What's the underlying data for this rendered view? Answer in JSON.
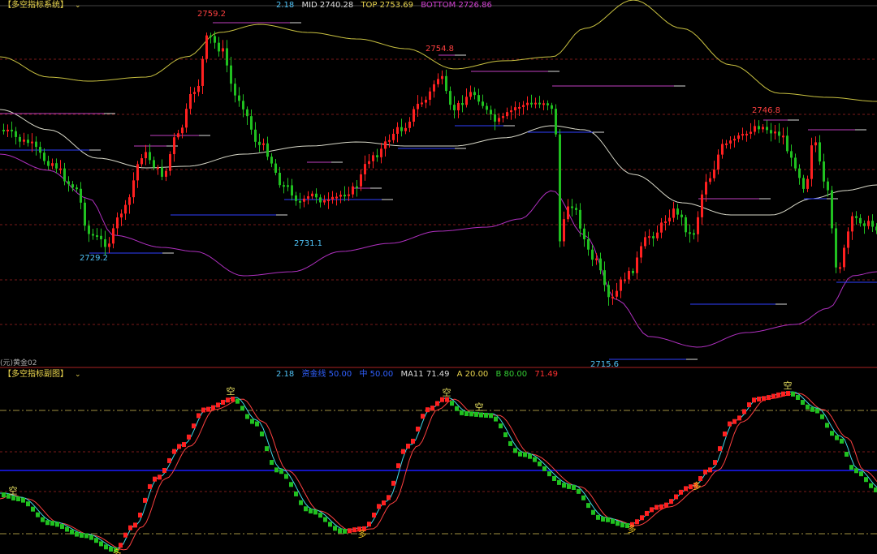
{
  "main_panel": {
    "title": "【多空指标系统】",
    "readouts": [
      {
        "text": "2.18",
        "color": "#4fc3f7"
      },
      {
        "text": "MID 2740.28",
        "color": "#dddddd"
      },
      {
        "text": "TOP 2753.69",
        "color": "#e8d44d"
      },
      {
        "text": "BOTTOM 2726.86",
        "color": "#d040d0"
      }
    ],
    "peak_labels": [
      {
        "text": "2759.2",
        "color": "#ff4040"
      },
      {
        "text": "2754.8",
        "color": "#ff4040"
      },
      {
        "text": "2746.8",
        "color": "#ff4040"
      }
    ],
    "trough_labels": [
      {
        "text": "2729.2",
        "color": "#4fc3f7"
      },
      {
        "text": "2731.1",
        "color": "#4fc3f7"
      },
      {
        "text": "2715.6",
        "color": "#4fc3f7"
      }
    ],
    "instrument_label": "黄金02",
    "axis_unit": "(元)"
  },
  "sub_panel": {
    "title": "【多空指标副图】",
    "readouts": [
      {
        "text": "2.18",
        "color": "#4fc3f7"
      },
      {
        "text": "资金线 50.00",
        "color": "#3060ff"
      },
      {
        "text": "中 50.00",
        "color": "#3060ff"
      },
      {
        "text": "MA11 71.49",
        "color": "#dddddd"
      },
      {
        "text": "A 20.00",
        "color": "#e8d44d"
      },
      {
        "text": "B 80.00",
        "color": "#33cc33"
      },
      {
        "text": "71.49",
        "color": "#ff3030"
      }
    ],
    "signals": [
      {
        "text": "空",
        "type": "sell"
      },
      {
        "text": "多",
        "type": "buy"
      },
      {
        "text": "空",
        "type": "sell"
      },
      {
        "text": "多",
        "type": "buy"
      },
      {
        "text": "空",
        "type": "sell"
      },
      {
        "text": "空",
        "type": "sell"
      },
      {
        "text": "多",
        "type": "buy"
      },
      {
        "text": "多",
        "type": "buy"
      },
      {
        "text": "空",
        "type": "sell"
      }
    ]
  },
  "colors": {
    "up": "#ff2020",
    "down": "#20c020",
    "top_band": "#c8c040",
    "mid_band": "#d8d8c8",
    "bottom_band": "#b030c0",
    "dashed": "#7a1a1a",
    "signal_line": "#1a1aff",
    "level_line": "#a09040"
  }
}
